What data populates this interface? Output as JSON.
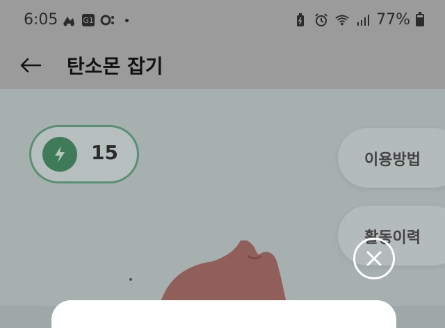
{
  "status_bar": {
    "time": "6:05",
    "battery": "77%",
    "left_icons": [
      "delivery-icon",
      "app-g1-icon",
      "app-o-icon",
      "notification-dot"
    ],
    "right_icons": [
      "battery-saver-icon",
      "alarm-icon",
      "wifi-icon",
      "signal-icon"
    ]
  },
  "app_bar": {
    "title": "탄소몬 잡기"
  },
  "energy": {
    "count": "15",
    "icon": "lightning-icon",
    "accent_color": "#3f7a59"
  },
  "side_buttons": {
    "usage_label": "이용방법",
    "history_label": "활동이력"
  },
  "close_button": {
    "icon": "close-icon"
  }
}
